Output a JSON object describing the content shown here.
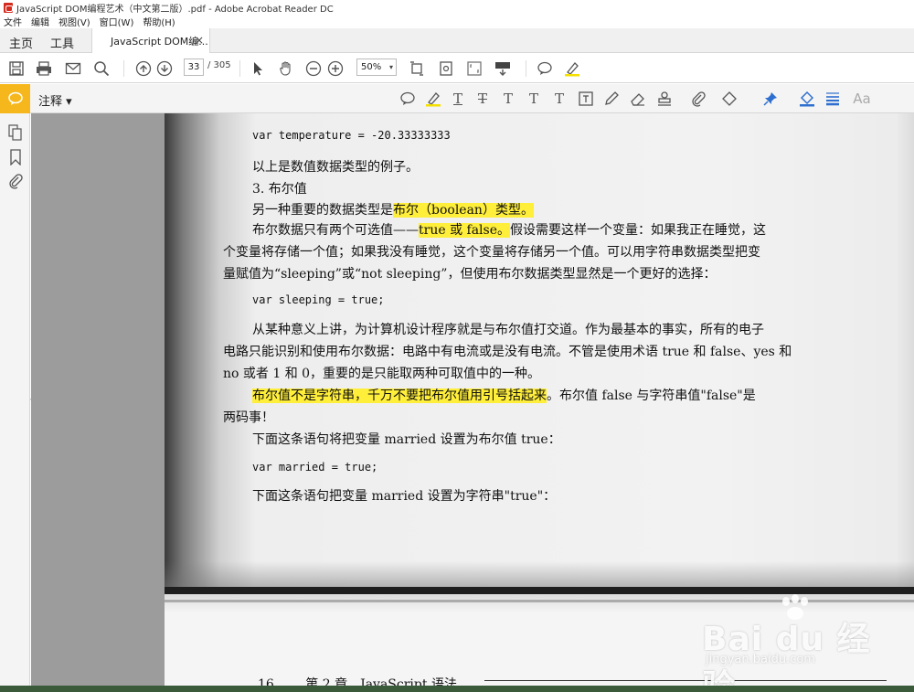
{
  "window": {
    "title": "JavaScript DOM编程艺术（中文第二版）.pdf - Adobe Acrobat Reader DC"
  },
  "menu": [
    "文件",
    "编辑",
    "视图(V)",
    "窗口(W)",
    "帮助(H)"
  ],
  "tabs": {
    "home": "主页",
    "tools": "工具",
    "document": "JavaScript DOM编...",
    "close": "×"
  },
  "toolbar": {
    "page_current": "33",
    "page_total": "/ 305",
    "zoom": "50%",
    "zoom_dropdown": "▾"
  },
  "comment_toolbar": {
    "label": "注释 ▾",
    "text_tools": [
      "T",
      "T",
      "T",
      "T",
      "T",
      "Aa"
    ]
  },
  "colors": {
    "accent": "#f5b71b",
    "highlight": "#ffee3a"
  },
  "document": {
    "lines": [
      {
        "text": "var temperature = -20.33333333",
        "style": "code"
      },
      {
        "text": "以上是数值数据类型的例子。",
        "style": "body"
      },
      {
        "text": "3. 布尔值",
        "style": "body"
      },
      {
        "pre": "另一种重要的数据类型是",
        "hl": "布尔（boolean）类型。",
        "post": ""
      },
      {
        "pre": "布尔数据只有两个可选值——",
        "hl": "true 或 false。",
        "post": "假设需要这样一个变量：如果我正在睡觉，这"
      },
      {
        "text": "个变量将存储一个值；如果我没有睡觉，这个变量将存储另一个值。可以用字符串数据类型把变",
        "style": "body"
      },
      {
        "text": "量赋值为“sleeping”或“not sleeping”，但使用布尔数据类型显然是一个更好的选择：",
        "style": "body"
      },
      {
        "text": "var sleeping = true;",
        "style": "code"
      },
      {
        "text": "从某种意义上讲，为计算机设计程序就是与布尔值打交道。作为最基本的事实，所有的电子",
        "style": "body"
      },
      {
        "text": "电路只能识别和使用布尔数据：电路中有电流或是没有电流。不管是使用术语 true 和 false、yes 和",
        "style": "body"
      },
      {
        "text": "no 或者 1 和 0，重要的是只能取两种可取值中的一种。",
        "style": "body"
      },
      {
        "pre": "",
        "hl": "布尔值不是字符串，千万不要把布尔值用引号括起来",
        "post": "。布尔值 false 与字符串值\"false\"是"
      },
      {
        "text": "两码事！",
        "style": "body"
      },
      {
        "text": "下面这条语句将把变量 married 设置为布尔值 true：",
        "style": "body"
      },
      {
        "text": "var married = true;",
        "style": "code"
      },
      {
        "text": "下面这条语句把变量 married 设置为字符串\"true\"：",
        "style": "body"
      }
    ],
    "footer": {
      "page_number": "16",
      "chapter": "第 2 章　JavaScript 语法"
    }
  },
  "watermark": {
    "brand": "Bai du 经验",
    "url": "jingyan.baidu.com"
  }
}
